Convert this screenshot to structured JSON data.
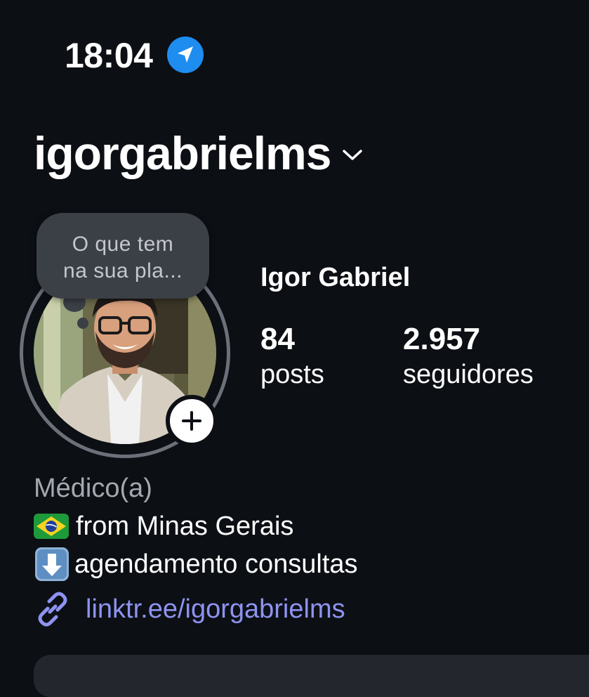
{
  "status_bar": {
    "time": "18:04",
    "location_icon": "location-arrow-icon",
    "accent_color": "#1f8cf0"
  },
  "header": {
    "username": "igorgabrielms",
    "switch_account_icon": "chevron-down-icon"
  },
  "note": {
    "line1": "O que tem",
    "line2": "na sua pla..."
  },
  "profile": {
    "display_name": "Igor Gabriel",
    "add_story_icon": "plus-icon"
  },
  "stats": {
    "posts": {
      "value": "84",
      "label": "posts"
    },
    "followers": {
      "value": "2.957",
      "label": "seguidores"
    }
  },
  "bio": {
    "category": "Médico(a)",
    "line1_emoji": "brazil-flag-icon",
    "line1_text": "from Minas Gerais",
    "line2_emoji": "down-arrow-icon",
    "line2_text": "agendamento consultas"
  },
  "link": {
    "icon": "link-icon",
    "text": "linktr.ee/igorgabrielms",
    "color": "#8d93ee"
  }
}
